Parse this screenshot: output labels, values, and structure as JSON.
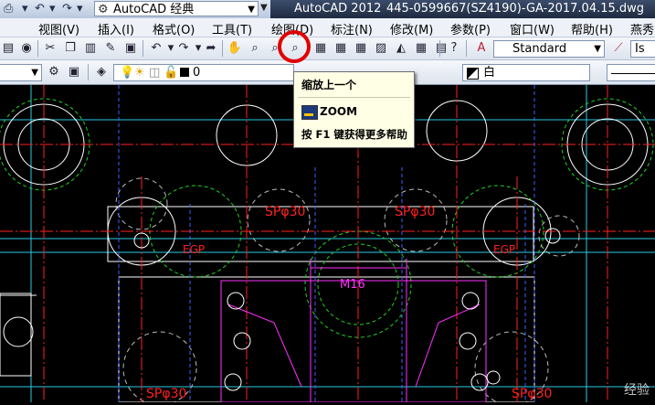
{
  "window": {
    "app_title": "AutoCAD 2012",
    "file_title": "445-0599667(SZ4190)-GA-2017.04.15.dwg",
    "workspace": "AutoCAD 经典"
  },
  "menu": [
    "视图(V)",
    "插入(I)",
    "格式(O)",
    "工具(T)",
    "绘图(D)",
    "标注(N)",
    "修改(M)",
    "参数(P)",
    "窗口(W)",
    "帮助(H)",
    "燕秀"
  ],
  "toolbar1": {
    "text_style": "Standard"
  },
  "toolbar2": {
    "layer_value": "0",
    "color_value": "白"
  },
  "tooltip": {
    "title": "缩放上一个",
    "command": "ZOOM",
    "help": "按 F1 键获得更多帮助"
  },
  "drawing": {
    "labels": [
      "SPφ30",
      "SPφ30",
      "SPφ30",
      "SPφ30",
      "EGP",
      "EGP",
      "M16"
    ]
  },
  "watermark": "经验",
  "colors": {
    "highlight": "#e00000",
    "canvas_bg": "#000000",
    "red": "#ff2020",
    "green": "#20d020",
    "magenta": "#ff30ff",
    "cyan": "#30e0ff",
    "white": "#ffffff"
  }
}
